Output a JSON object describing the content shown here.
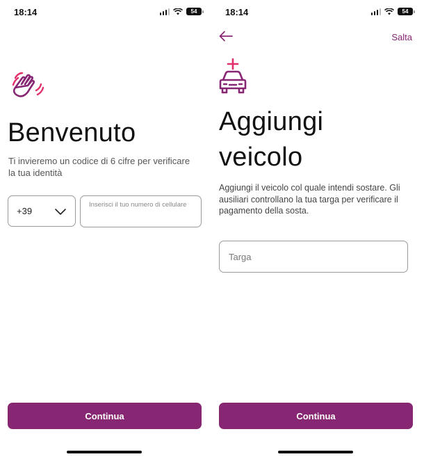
{
  "colors": {
    "brand": "#872773",
    "accent_pink": "#e1306c",
    "border": "#9a9a9a"
  },
  "screens": {
    "welcome": {
      "status_time": "18:14",
      "battery": "54",
      "icon": "waving-hand-icon",
      "title": "Benvenuto",
      "subtitle": "Ti invieremo un codice di 6 cifre per verificare la tua identità",
      "country_code": "+39",
      "phone_placeholder": "Inserisci il tuo numero di cellulare",
      "continue_label": "Continua"
    },
    "add_vehicle": {
      "status_time": "18:14",
      "battery": "54",
      "skip_label": "Salta",
      "icon": "car-add-icon",
      "title": "Aggiungi veicolo",
      "subtitle": "Aggiungi il veicolo col quale intendi sostare. Gli ausiliari controllano la tua targa per verificare il pagamento della sosta.",
      "plate_placeholder": "Targa",
      "continue_label": "Continua"
    }
  }
}
